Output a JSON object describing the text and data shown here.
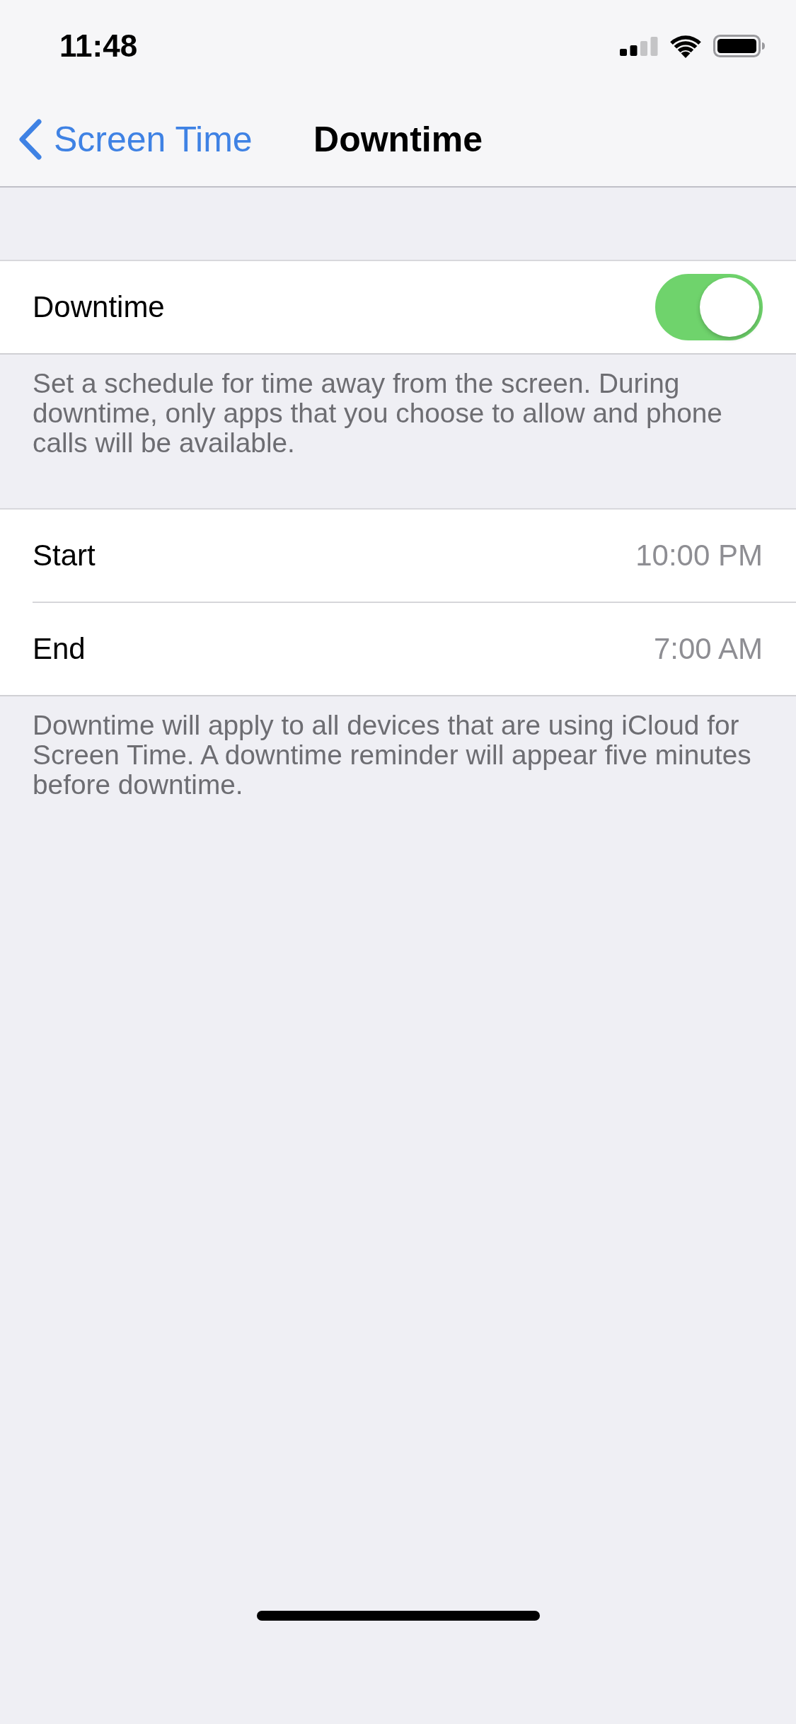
{
  "status_bar": {
    "time": "11:48"
  },
  "nav_bar": {
    "back_label": "Screen Time",
    "title": "Downtime"
  },
  "sections": [
    {
      "rows": [
        {
          "kind": "toggle",
          "label": "Downtime",
          "on": true
        }
      ],
      "footer": "Set a schedule for time away from the screen. During downtime, only apps that you choose to allow and phone calls will be available."
    },
    {
      "rows": [
        {
          "kind": "value",
          "label": "Start",
          "value": "10:00 PM"
        },
        {
          "kind": "value",
          "label": "End",
          "value": "7:00 AM"
        }
      ],
      "footer": "Downtime will apply to all devices that are using iCloud for Screen Time. A downtime reminder will appear five minutes before downtime."
    }
  ]
}
